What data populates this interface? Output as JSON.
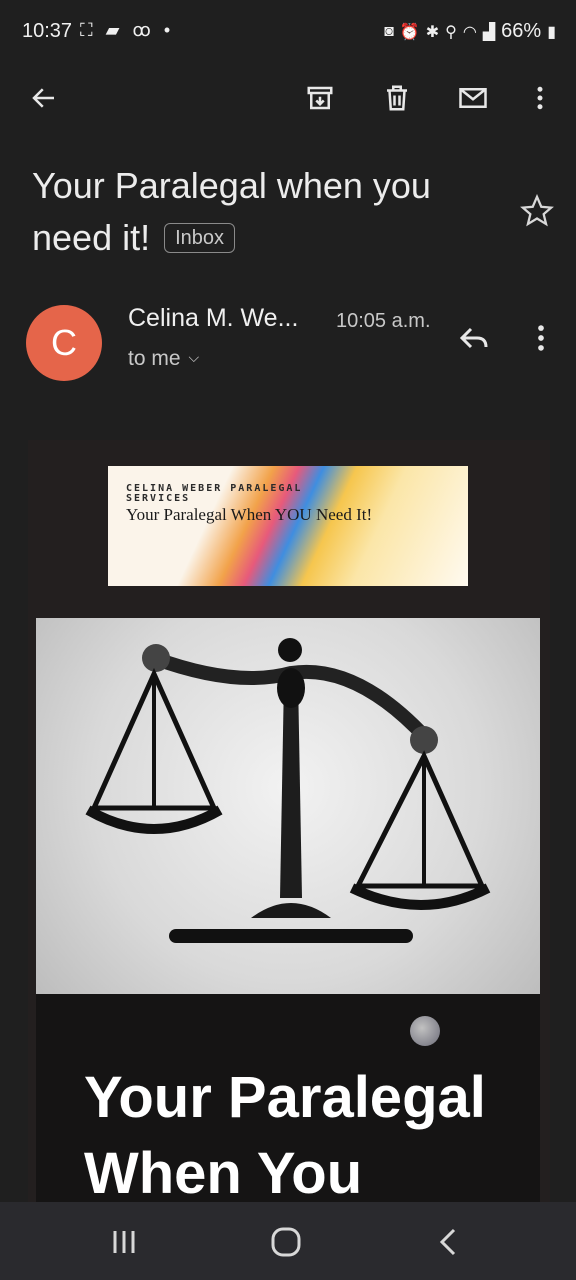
{
  "status_bar": {
    "time": "10:37",
    "left_icons": [
      "screenshot-icon",
      "chat-icon",
      "voicemail-icon",
      "dot-icon"
    ],
    "right_icons": [
      "data-saver-icon",
      "alarm-icon",
      "bluetooth-icon",
      "location-icon",
      "wifi-icon",
      "signal-icon"
    ],
    "battery": "66%"
  },
  "toolbar": {
    "icons": [
      "back-arrow-icon",
      "archive-icon",
      "delete-icon",
      "mark-unread-icon",
      "more-vert-icon"
    ]
  },
  "email": {
    "subject": "Your Paralegal when you need it!",
    "label": "Inbox",
    "avatar_letter": "C",
    "avatar_color": "#e5654a",
    "sender": "Celina M. We...",
    "time": "10:05 a.m.",
    "recipient": "to me"
  },
  "body": {
    "banner_small": "CELINA WEBER PARALEGAL SERVICES",
    "banner_big": "Your Paralegal When YOU Need It!",
    "image_subject": "scales-of-justice",
    "promo_heading": "Your Paralegal When You"
  },
  "nav": {
    "icons": [
      "recent-apps-icon",
      "home-icon",
      "back-icon"
    ]
  }
}
